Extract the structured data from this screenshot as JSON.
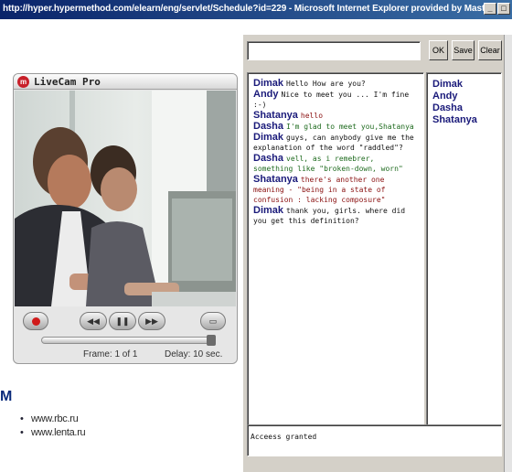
{
  "window": {
    "title": "http://hyper.hypermethod.com/elearn/eng/servlet/Schedule?id=229 - Microsoft Internet Explorer provided by Master"
  },
  "livecam": {
    "title": "LiveCam Pro",
    "frame_label": "Frame: 1 of 1",
    "delay_label": "Delay: 10 sec."
  },
  "left_page": {
    "m_letter": "M",
    "links": [
      "www.rbc.ru",
      "www.lenta.ru"
    ]
  },
  "chat": {
    "message_input": {
      "value": "",
      "placeholder": ""
    },
    "buttons": {
      "ok": "OK",
      "save": "Save",
      "clear": "Clear"
    },
    "messages": [
      {
        "nick": "Dimak",
        "text": "Hello How are you?",
        "color": "#111111"
      },
      {
        "nick": "Andy",
        "text": "Nice to meet you ... I'm fine :-)",
        "color": "#111111"
      },
      {
        "nick": "Shatanya",
        "text": "hello",
        "color": "#8a1010"
      },
      {
        "nick": "Dasha",
        "text": "I'm glad to meet you,Shatanya",
        "color": "#1f6b1f"
      },
      {
        "nick": "Dimak",
        "text": "guys, can anybody give me the explanation of the word \"raddled\"?",
        "color": "#111111"
      },
      {
        "nick": "Dasha",
        "text": "vell, as i remebrer, something like \"broken-down, worn\"",
        "color": "#1f6b1f"
      },
      {
        "nick": "Shatanya",
        "text": "there's another one meaning - \"being in a state of confusion : lacking composure\"",
        "color": "#8a1010"
      },
      {
        "nick": "Dimak",
        "text": "thank you, girls. where did you get this definition?",
        "color": "#111111"
      }
    ],
    "users": [
      "Dimak",
      "Andy",
      "Dasha",
      "Shatanya"
    ],
    "status": "Acceess granted"
  }
}
